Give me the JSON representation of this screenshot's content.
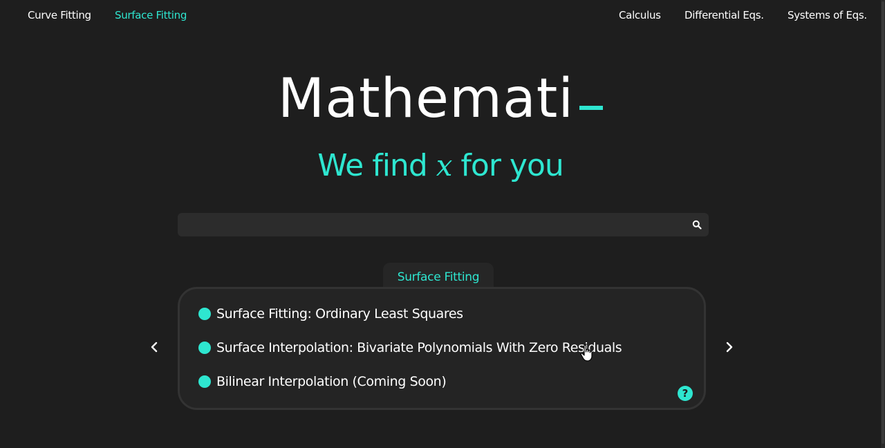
{
  "nav": {
    "left": [
      {
        "label": "Curve Fitting",
        "active": false
      },
      {
        "label": "Surface Fitting",
        "active": true
      }
    ],
    "right": [
      {
        "label": "Calculus"
      },
      {
        "label": "Differential Eqs."
      },
      {
        "label": "Systems of Eqs."
      }
    ]
  },
  "hero": {
    "logo": "Mathemati",
    "tagline_before": "We find ",
    "tagline_var": "x",
    "tagline_after": " for you"
  },
  "search": {
    "value": "",
    "placeholder": "",
    "icon": "search-icon"
  },
  "panel": {
    "tab_label": "Surface Fitting",
    "items": [
      {
        "label": "Surface Fitting: Ordinary Least Squares"
      },
      {
        "label": "Surface Interpolation: Bivariate Polynomials With Zero Residuals"
      },
      {
        "label": "Bilinear Interpolation (Coming Soon)"
      }
    ],
    "help_label": "?"
  },
  "colors": {
    "accent": "#2ee6d0",
    "background": "#1e1e1e",
    "panel": "#242424"
  }
}
